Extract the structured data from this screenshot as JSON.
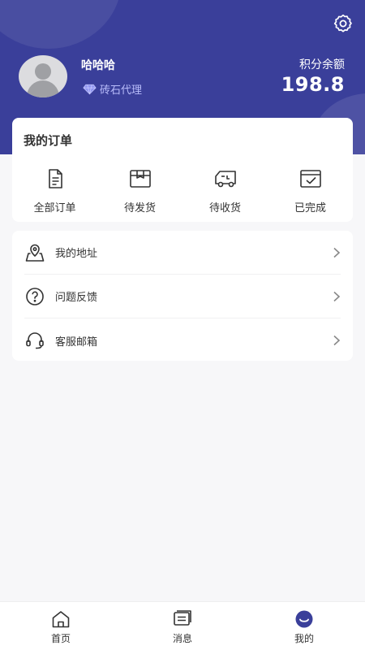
{
  "header": {
    "username": "哈哈哈",
    "level_label": "砖石代理",
    "points_label": "积分余额",
    "points_value": "198.8"
  },
  "orders": {
    "title": "我的订单",
    "items": [
      {
        "label": "全部订单",
        "icon": "order-list-icon"
      },
      {
        "label": "待发货",
        "icon": "box-icon"
      },
      {
        "label": "待收货",
        "icon": "truck-icon"
      },
      {
        "label": "已完成",
        "icon": "completed-icon"
      }
    ]
  },
  "menu": {
    "items": [
      {
        "label": "我的地址",
        "icon": "location-icon"
      },
      {
        "label": "问题反馈",
        "icon": "question-icon"
      },
      {
        "label": "客服邮箱",
        "icon": "headset-icon"
      }
    ]
  },
  "tabbar": {
    "items": [
      {
        "label": "首页",
        "icon": "home-icon"
      },
      {
        "label": "消息",
        "icon": "message-icon"
      },
      {
        "label": "我的",
        "icon": "profile-icon",
        "active": true
      }
    ]
  },
  "colors": {
    "primary": "#3a3f9a",
    "level_text": "#b9bdfb",
    "background": "#f7f7f9"
  }
}
